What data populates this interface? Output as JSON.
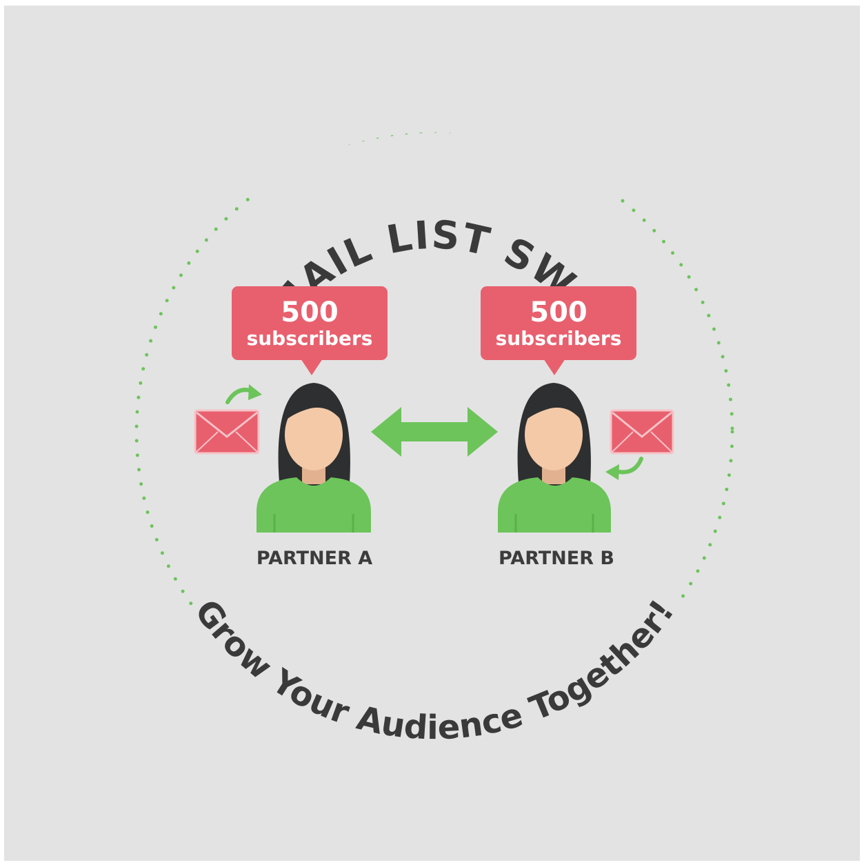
{
  "title": "EMAIL LIST SWAP",
  "tagline": "Grow Your Audience Together!",
  "partners": [
    {
      "label": "PARTNER A",
      "count": "500",
      "unit": "subscribers"
    },
    {
      "label": "PARTNER B",
      "count": "500",
      "unit": "subscribers"
    }
  ],
  "colors": {
    "background": "#e3e3e3",
    "accent_red": "#e8606e",
    "accent_green": "#6cc45a",
    "text": "#3a3a3a",
    "skin": "#f3c9a8",
    "hair": "#2e2f30"
  },
  "icons": [
    "envelope-icon",
    "curved-arrow-icon",
    "double-arrow-icon",
    "person-icon"
  ]
}
